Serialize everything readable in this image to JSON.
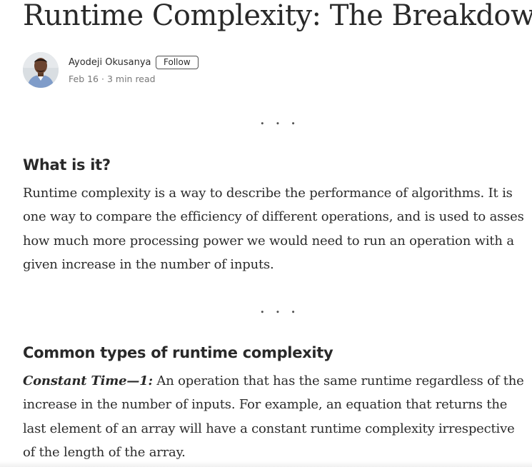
{
  "article": {
    "title": "Runtime Complexity: The Breakdown",
    "author": {
      "name": "Ayodeji Okusanya",
      "follow_label": "Follow",
      "date": "Feb 16",
      "meta_separator": "·",
      "read_time": "3 min read"
    },
    "separator": "...",
    "sections": [
      {
        "heading": "What is it?",
        "lines": [
          "Runtime complexity is a way to describe the performance of algorithms. It is",
          "one way to compare the efficiency of different operations, and is used to asses",
          "how much more processing power we would need to run an operation with a",
          "given increase in the number of inputs."
        ]
      },
      {
        "heading": "Common types of runtime complexity",
        "emphasis": "Constant Time—1:",
        "lines": [
          " An operation that has the same runtime regardless of the",
          "increase in the number of inputs. For example, an equation that returns the",
          "last element of an array will have a constant runtime complexity irrespective",
          "of the length of the array."
        ]
      }
    ]
  },
  "colors": {
    "text": "#292929",
    "muted": "#757575",
    "background": "#ffffff"
  }
}
